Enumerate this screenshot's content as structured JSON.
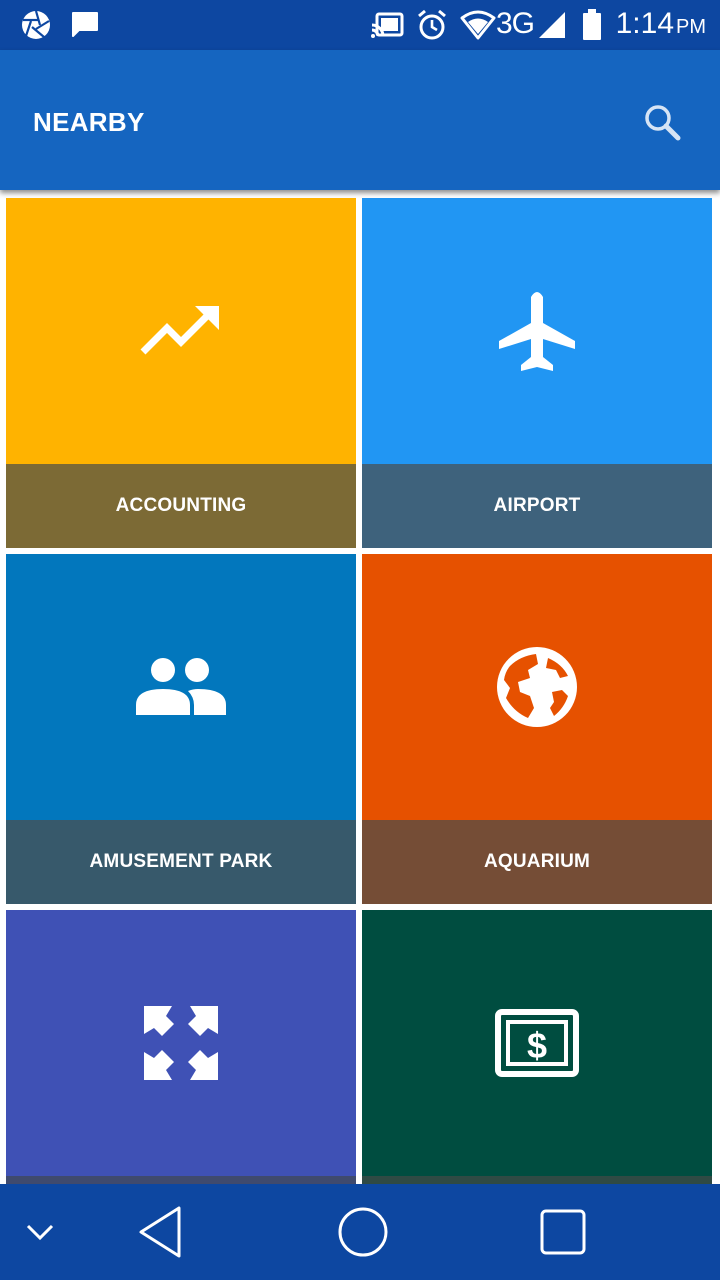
{
  "status_bar": {
    "time": "1:14",
    "ampm": "PM",
    "network": "3G",
    "icons": [
      "shutter-icon",
      "message-icon",
      "cast-icon",
      "alarm-icon",
      "wifi-icon",
      "signal-icon",
      "battery-icon"
    ]
  },
  "app_bar": {
    "title": "NEARBY",
    "search_icon": "search-icon"
  },
  "categories": [
    {
      "label": "ACCOUNTING",
      "icon": "trending-up-icon",
      "color": "#ffb300",
      "label_color": "#7c6a35"
    },
    {
      "label": "AIRPORT",
      "icon": "airplane-icon",
      "color": "#2196f3",
      "label_color": "#3e627c"
    },
    {
      "label": "AMUSEMENT PARK",
      "icon": "people-icon",
      "color": "#0277bd",
      "label_color": "#37596b"
    },
    {
      "label": "AQUARIUM",
      "icon": "globe-icon",
      "color": "#e65100",
      "label_color": "#754d36"
    },
    {
      "label": "",
      "icon": "fullscreen-icon",
      "color": "#3f51b5",
      "label_color": "#3f4a6e"
    },
    {
      "label": "",
      "icon": "money-icon",
      "color": "#004d40",
      "label_color": "#2f4a44"
    }
  ],
  "nav_bar": {
    "icons": [
      "chevron-down-icon",
      "back-icon",
      "home-icon",
      "recents-icon"
    ]
  }
}
